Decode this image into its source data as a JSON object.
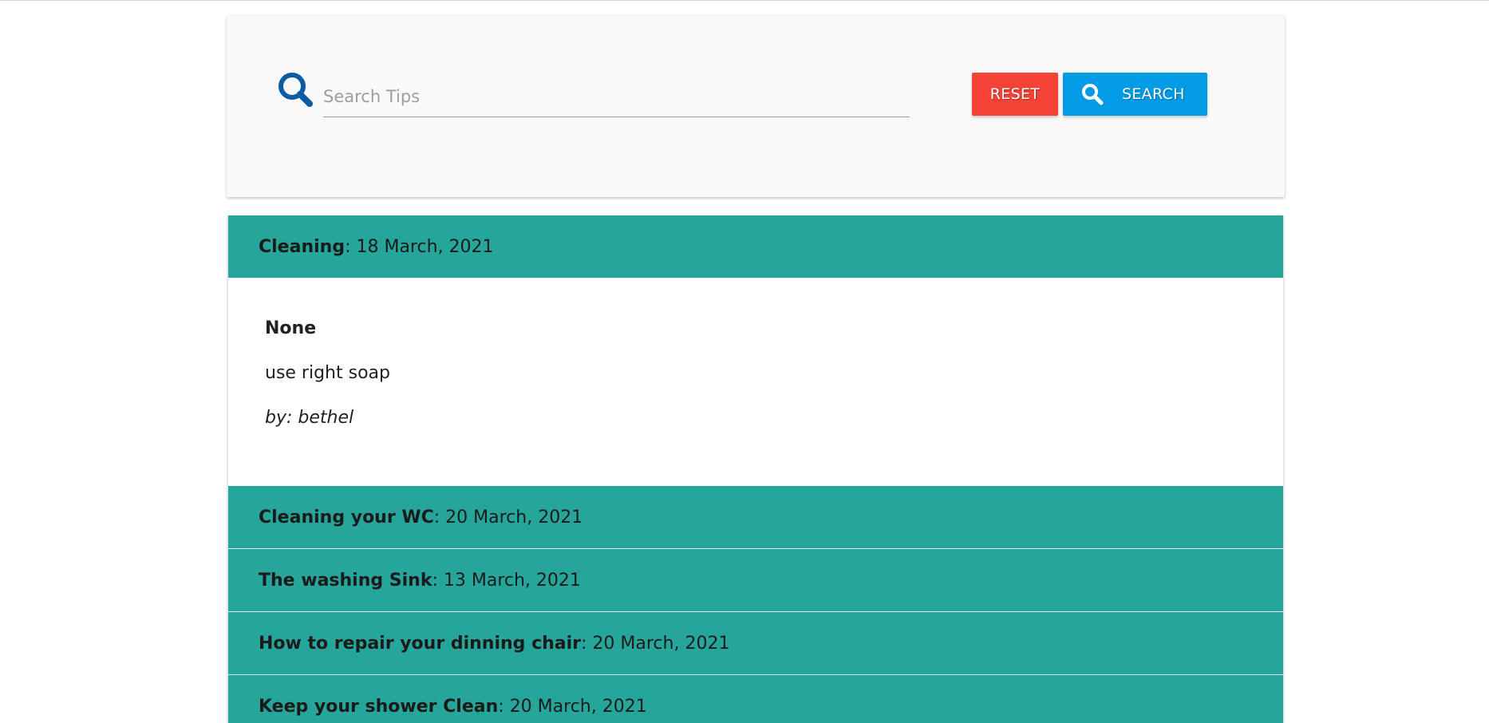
{
  "search": {
    "placeholder": "Search Tips",
    "value": "",
    "reset_label": "RESET",
    "search_label": "SEARCH",
    "icon": "search-icon"
  },
  "colors": {
    "accent_teal": "#26a69a",
    "reset_red": "#f44336",
    "search_blue": "#039be5",
    "icon_blue": "#0d5ba3"
  },
  "tips": [
    {
      "title": "Cleaning",
      "date": "18 March, 2021",
      "expanded": true,
      "body_title": "None",
      "body_text": "use right soap",
      "author": "by: bethel"
    },
    {
      "title": "Cleaning your WC",
      "date": "20 March, 2021",
      "expanded": false
    },
    {
      "title": "The washing Sink",
      "date": "13 March, 2021",
      "expanded": false
    },
    {
      "title": "How to repair your dinning chair",
      "date": "20 March, 2021",
      "expanded": false
    },
    {
      "title": "Keep your shower Clean",
      "date": "20 March, 2021",
      "expanded": false
    }
  ]
}
